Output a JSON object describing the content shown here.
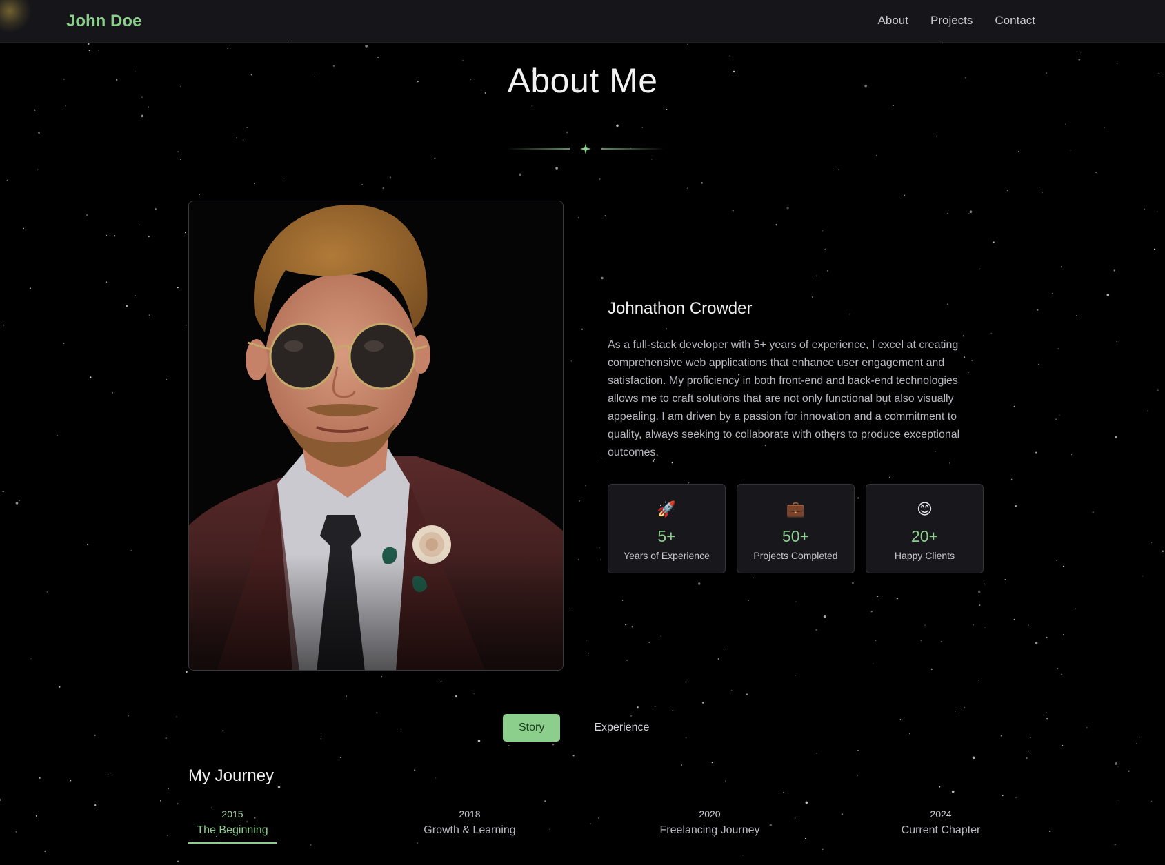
{
  "nav": {
    "brand": "John Doe",
    "links": [
      "About",
      "Projects",
      "Contact"
    ]
  },
  "header": {
    "title": "About Me",
    "divider_icon": "sparkle-icon"
  },
  "profile": {
    "photo_icon": "portrait-photo",
    "name": "Johnathon Crowder",
    "bio": "As a full-stack developer with 5+ years of experience, I excel at creating comprehensive web applications that enhance user engagement and satisfaction. My proficiency in both front-end and back-end technologies allows me to craft solutions that are not only functional but also visually appealing. I am driven by a passion for innovation and a commitment to quality, always seeking to collaborate with others to produce exceptional outcomes."
  },
  "stats": [
    {
      "icon": "🚀",
      "icon_name": "rocket-icon",
      "value": "5+",
      "label": "Years of Experience"
    },
    {
      "icon": "💼",
      "icon_name": "briefcase-icon",
      "value": "50+",
      "label": "Projects Completed"
    },
    {
      "icon": "😊",
      "icon_name": "smile-icon",
      "value": "20+",
      "label": "Happy Clients"
    }
  ],
  "tabs": {
    "items": [
      "Story",
      "Experience"
    ],
    "active": "Story"
  },
  "journey": {
    "title": "My Journey",
    "items": [
      {
        "year": "2015",
        "label": "The Beginning",
        "active": true
      },
      {
        "year": "2018",
        "label": "Growth & Learning",
        "active": false
      },
      {
        "year": "2020",
        "label": "Freelancing Journey",
        "active": false
      },
      {
        "year": "2024",
        "label": "Current Chapter",
        "active": false
      }
    ]
  },
  "colors": {
    "accent": "#8ccf8c",
    "background": "#000000",
    "navbar": "#15151a",
    "card": "#17171c",
    "text_muted": "#b9b9c0"
  }
}
